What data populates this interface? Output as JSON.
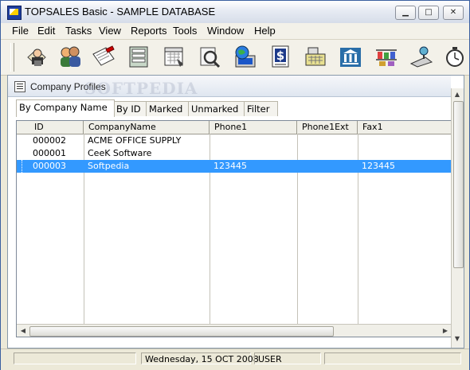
{
  "window": {
    "title": "TOPSALES Basic - SAMPLE DATABASE"
  },
  "menu": [
    "File",
    "Edit",
    "Tasks",
    "View",
    "Reports",
    "Tools",
    "Window",
    "Help"
  ],
  "toolbar": [
    {
      "icon": "contacts-icon"
    },
    {
      "icon": "users-icon"
    },
    {
      "icon": "letter-icon"
    },
    {
      "icon": "files-icon"
    },
    {
      "icon": "calendar-icon"
    },
    {
      "icon": "search-document-icon"
    },
    {
      "icon": "web-icon"
    },
    {
      "icon": "invoice-icon"
    },
    {
      "icon": "cash-register-icon"
    },
    {
      "icon": "bank-icon"
    },
    {
      "icon": "products-icon"
    },
    {
      "icon": "service-icon"
    },
    {
      "icon": "timer-icon"
    }
  ],
  "child_window": {
    "title": "Company Profiles",
    "watermark": "SOFTPEDIA"
  },
  "tabs": [
    "By Company Name",
    "By ID",
    "Marked",
    "Unmarked",
    "Filter"
  ],
  "grid": {
    "columns": [
      "ID",
      "CompanyName",
      "Phone1",
      "Phone1Ext",
      "Fax1"
    ],
    "rows": [
      {
        "id": "000002",
        "company": "ACME OFFICE SUPPLY",
        "phone1": "",
        "phone1ext": "",
        "fax1": ""
      },
      {
        "id": "000001",
        "company": "CeeK Software",
        "phone1": "",
        "phone1ext": "",
        "fax1": ""
      },
      {
        "id": "000003",
        "company": "Softpedia",
        "phone1": "123445",
        "phone1ext": "",
        "fax1": "123445",
        "selected": true
      }
    ]
  },
  "status": {
    "date": "Wednesday, 15 OCT 2008",
    "user": "USER"
  },
  "colors": {
    "selection": "#3399ff",
    "titlebar": "#dfe6f0"
  }
}
